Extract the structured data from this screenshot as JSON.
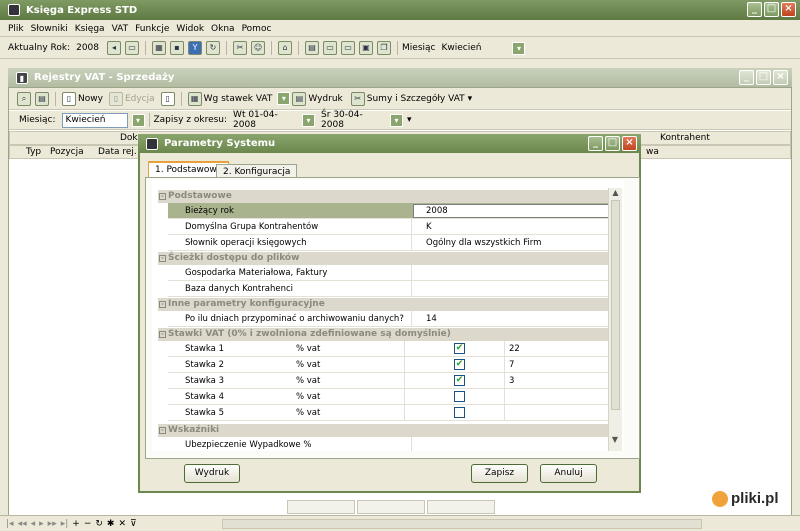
{
  "app": {
    "title": "Księga Express STD"
  },
  "menu": [
    "Plik",
    "Słowniki",
    "Księga",
    "VAT",
    "Funkcje",
    "Widok",
    "Okna",
    "Pomoc"
  ],
  "toolbar": {
    "year_label": "Aktualny Rok:",
    "year_value": "2008",
    "month_label": "Miesiąc",
    "month_value": "Kwiecień"
  },
  "child": {
    "title": "Rejestry VAT - Sprzedaży",
    "toolbar": {
      "new": "Nowy",
      "edit": "Edycja",
      "rates": "Wg stawek VAT",
      "print": "Wydruk",
      "sums": "Sumy i Szczegóły VAT"
    },
    "filter": {
      "month_label": "Miesiąc:",
      "month_value": "Kwiecień",
      "range_label": "Zapisy z okresu:",
      "from": "Wt 01-04-2008",
      "to": "Śr 30-04-2008"
    },
    "columns": {
      "top_doc": "Doku",
      "top_contr": "Kontrahent",
      "typ": "Typ",
      "pozycja": "Pozycja",
      "data": "Data rej.",
      "wa": "wa"
    }
  },
  "dialog": {
    "title": "Parametry Systemu",
    "tabs": [
      "1. Podstawowe",
      "2. Konfiguracja"
    ],
    "sections": {
      "s1": "Podstawowe",
      "s2": "Ścieżki dostępu do plików",
      "s3": "Inne parametry konfiguracyjne",
      "s4": "Stawki VAT (0% i zwolniona zdefiniowane są domyślnie)",
      "s5": "Wskaźniki"
    },
    "rows": {
      "r1": {
        "label": "Bieżący rok",
        "value": "2008"
      },
      "r2": {
        "label": "Domyślna Grupa Kontrahentów",
        "value": "K"
      },
      "r3": {
        "label": "Słownik operacji księgowych",
        "value": "Ogólny dla wszystkich Firm"
      },
      "r4": {
        "label": "Gospodarka Materiałowa, Faktury",
        "value": ""
      },
      "r5": {
        "label": "Baza danych Kontrahenci",
        "value": ""
      },
      "r6": {
        "label": "Po ilu dniach przypominać o archiwowaniu danych?",
        "value": "14"
      },
      "r7": {
        "label": "Ubezpieczenie Wypadkowe %",
        "value": ""
      }
    },
    "vat": [
      {
        "label": "Stawka 1",
        "unit": "% vat",
        "checked": true,
        "value": "22"
      },
      {
        "label": "Stawka 2",
        "unit": "% vat",
        "checked": true,
        "value": "7"
      },
      {
        "label": "Stawka 3",
        "unit": "% vat",
        "checked": true,
        "value": "3"
      },
      {
        "label": "Stawka 4",
        "unit": "% vat",
        "checked": false,
        "value": ""
      },
      {
        "label": "Stawka 5",
        "unit": "% vat",
        "checked": false,
        "value": ""
      }
    ],
    "buttons": {
      "print": "Wydruk",
      "save": "Zapisz",
      "cancel": "Anuluj"
    }
  },
  "watermark": {
    "text": "pliki.pl"
  },
  "colors": {
    "accent": "#6b874d",
    "selection": "#a9b48e",
    "check": "#21a121"
  }
}
